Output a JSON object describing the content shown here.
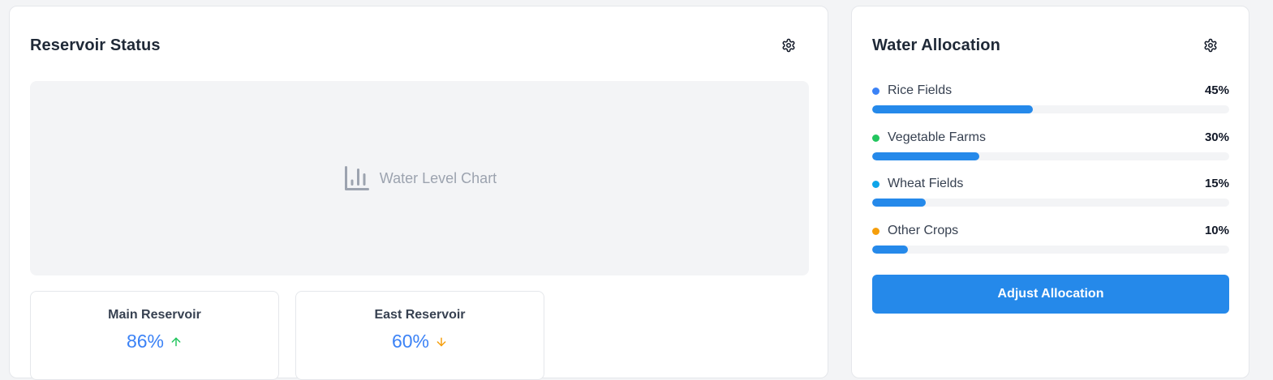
{
  "reservoir": {
    "title": "Reservoir Status",
    "settings_icon": "gear-icon",
    "chart_placeholder": {
      "icon": "bar-chart-icon",
      "label": "Water Level Chart"
    },
    "stats": [
      {
        "label": "Main Reservoir",
        "value": "86%",
        "trend": "up",
        "trend_color": "#22c55e"
      },
      {
        "label": "East Reservoir",
        "value": "60%",
        "trend": "down",
        "trend_color": "#f59e0b"
      }
    ]
  },
  "allocation": {
    "title": "Water Allocation",
    "settings_icon": "gear-icon",
    "items": [
      {
        "name": "Rice Fields",
        "percent_label": "45%",
        "fraction": 0.45,
        "dot_color": "#3b82f6"
      },
      {
        "name": "Vegetable Farms",
        "percent_label": "30%",
        "fraction": 0.3,
        "dot_color": "#22c55e"
      },
      {
        "name": "Wheat Fields",
        "percent_label": "15%",
        "fraction": 0.15,
        "dot_color": "#0ea5e9"
      },
      {
        "name": "Other Crops",
        "percent_label": "10%",
        "fraction": 0.1,
        "dot_color": "#f59e0b"
      }
    ],
    "button_label": "Adjust Allocation"
  },
  "colors": {
    "accent": "#2589ea",
    "stat_value": "#3b82f6",
    "placeholder_text": "#9ca3af"
  }
}
